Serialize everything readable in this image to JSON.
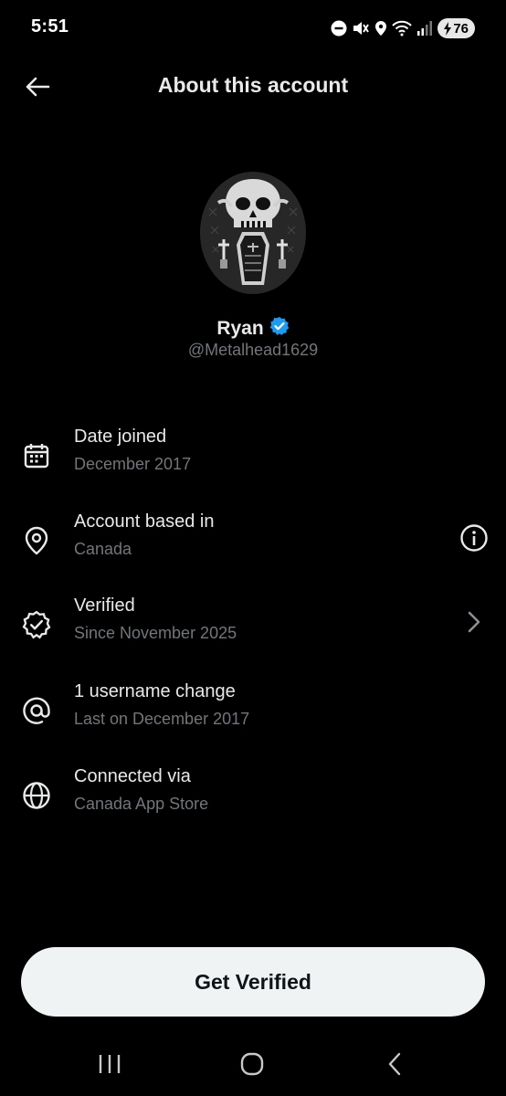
{
  "status_bar": {
    "time": "5:51",
    "battery_level": "76",
    "icons": [
      "do-not-disturb-icon",
      "mute-icon",
      "location-icon",
      "wifi-icon",
      "signal-icon",
      "battery-charging-icon"
    ]
  },
  "header": {
    "title": "About this account",
    "back_icon": "arrow-left-icon"
  },
  "profile": {
    "name": "Ryan",
    "handle": "@Metalhead1629",
    "verified_badge_color": "#1d9bf0"
  },
  "info_items": [
    {
      "icon": "calendar-icon",
      "title": "Date joined",
      "subtitle": "December 2017"
    },
    {
      "icon": "location-pin-icon",
      "title": "Account based in",
      "subtitle": "Canada",
      "action_icon": "info-icon"
    },
    {
      "icon": "verified-check-icon",
      "title": "Verified",
      "subtitle": "Since November 2025",
      "action_icon": "chevron-right-icon"
    },
    {
      "icon": "at-sign-icon",
      "title": "1 username change",
      "subtitle": "Last on December 2017"
    },
    {
      "icon": "globe-icon",
      "title": "Connected via",
      "subtitle": "Canada App Store"
    }
  ],
  "cta": {
    "label": "Get Verified"
  },
  "nav": [
    "recent-apps-icon",
    "home-icon",
    "back-icon"
  ],
  "colors": {
    "background": "#000000",
    "primary_text": "#e7e9ea",
    "secondary_text": "#71767b",
    "button_bg": "#eff3f4",
    "verified_blue": "#1d9bf0"
  }
}
